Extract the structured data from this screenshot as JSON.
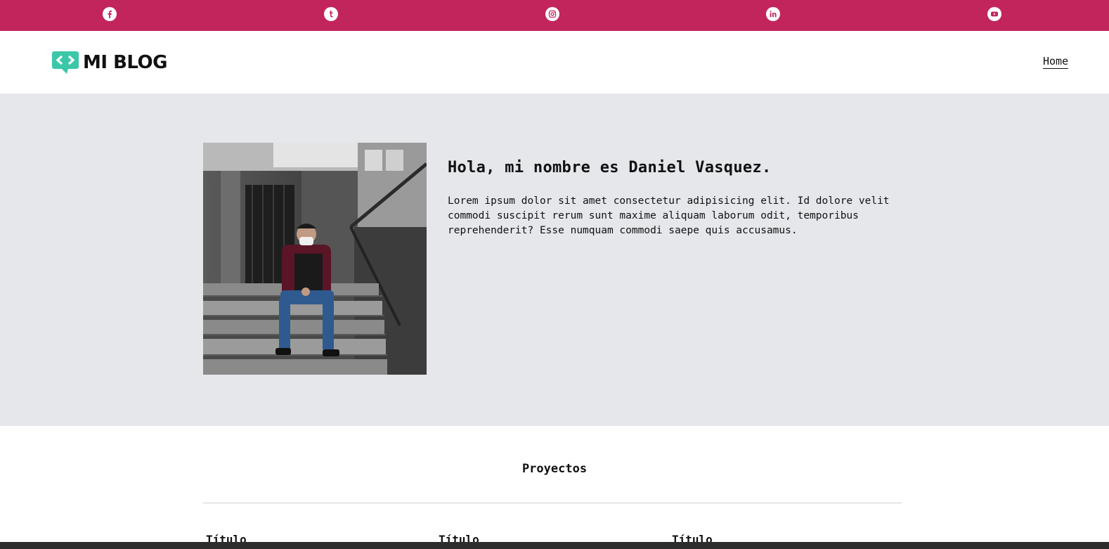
{
  "social": {
    "background": "#c2255c",
    "icons": [
      {
        "name": "facebook-icon"
      },
      {
        "name": "tumblr-icon"
      },
      {
        "name": "instagram-icon"
      },
      {
        "name": "linkedin-icon"
      },
      {
        "name": "youtube-icon"
      }
    ]
  },
  "header": {
    "logo_text": "MI BLOG",
    "logo_color": "#3cc7a8",
    "nav": [
      {
        "label": "Home"
      }
    ]
  },
  "hero": {
    "background": "#e5e7eb",
    "title": "Hola, mi nombre es Daniel Vasquez.",
    "text": "Lorem ipsum dolor sit amet consectetur adipisicing elit. Id dolore velit commodi suscipit rerum sunt maxime aliquam laborum odit, temporibus reprehenderit? Esse numquam commodi saepe quis accusamus."
  },
  "projects": {
    "title": "Proyectos",
    "cards": [
      {
        "title": "Título"
      },
      {
        "title": "Título"
      },
      {
        "title": "Título"
      }
    ]
  }
}
